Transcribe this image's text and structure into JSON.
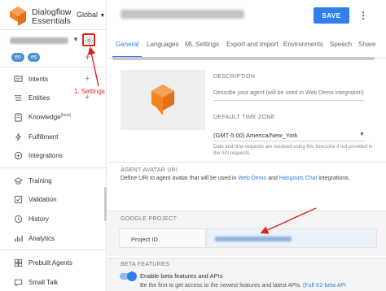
{
  "sidebar": {
    "brand_line1": "Dialogflow",
    "brand_line2": "Essentials",
    "region": "Global",
    "languages": [
      "en",
      "es"
    ],
    "items": [
      {
        "label": "Intents",
        "icon": "chat-icon"
      },
      {
        "label": "Entities",
        "icon": "entities-icon"
      },
      {
        "label": "Knowledge",
        "sup": "[beta]",
        "icon": "knowledge-icon"
      },
      {
        "label": "Fulfillment",
        "icon": "bolt-icon"
      },
      {
        "label": "Integrations",
        "icon": "integrations-icon"
      },
      {
        "label": "Training",
        "icon": "training-icon"
      },
      {
        "label": "Validation",
        "icon": "check-icon"
      },
      {
        "label": "History",
        "icon": "history-icon"
      },
      {
        "label": "Analytics",
        "icon": "analytics-icon"
      },
      {
        "label": "Prebuilt Agents",
        "icon": "prebuilt-icon"
      },
      {
        "label": "Small Talk",
        "icon": "smalltalk-icon"
      }
    ]
  },
  "annotation": {
    "settings_label": "1. Settings",
    "color": "#e02020"
  },
  "header": {
    "save_label": "SAVE",
    "more_icon": "more-vert-icon"
  },
  "tabs": [
    "General",
    "Languages",
    "ML Settings",
    "Export and Import",
    "Environments",
    "Speech",
    "Share"
  ],
  "general": {
    "description_label": "DESCRIPTION",
    "description_placeholder": "Describe your agent (will be used in Web Demo integration)",
    "timezone_label": "DEFAULT TIME ZONE",
    "timezone_value": "(GMT-5:00) America/New_York",
    "timezone_help": "Date and time requests are resolved using this timezone if not provided in the API requests."
  },
  "agent_avatar": {
    "heading": "AGENT AVATAR URI",
    "text_before": "Define URI to agent avatar that will be used in ",
    "link1": "Web Demo",
    "text_mid": " and ",
    "link2": "Hangouts Chat",
    "text_after": " integrations."
  },
  "google_project": {
    "heading": "GOOGLE PROJECT",
    "project_id_label": "Project ID"
  },
  "beta": {
    "heading": "BETA FEATURES",
    "toggle_label": "Enable beta features and APIs",
    "note_text": "Be the first to get access to the newest features and latest APIs. ",
    "note_link": "(Full V2-beta API"
  },
  "colors": {
    "accent": "#2f80ed",
    "logo_orange": "#f58220",
    "annotation_red": "#e02020"
  }
}
